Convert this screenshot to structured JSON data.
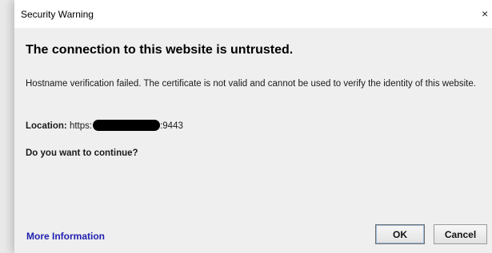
{
  "dialog": {
    "title": "Security Warning",
    "close_glyph": "×",
    "headline": "The connection to this website is untrusted.",
    "message": "Hostname verification failed.  The certificate is not valid and cannot be used to verify the identity of this website.",
    "location_label": "Location:",
    "location_prefix": " https:",
    "location_suffix": ":9443",
    "question": "Do you want to continue?",
    "more_info_link": "More Information",
    "ok_button": "OK",
    "cancel_button": "Cancel"
  },
  "colors": {
    "link": "#1f1fb0",
    "content_background": "#efefef"
  }
}
